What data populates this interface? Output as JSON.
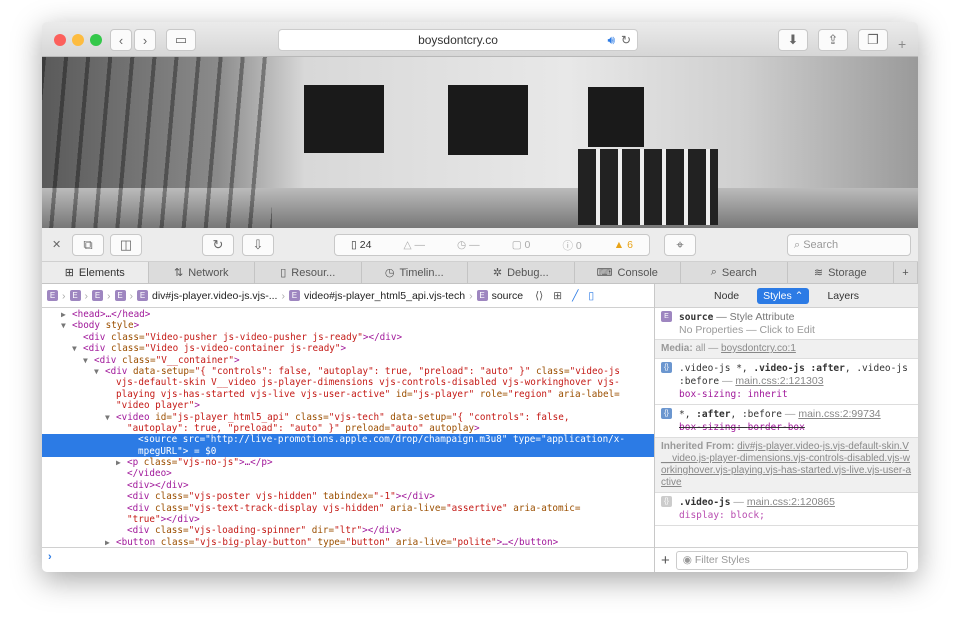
{
  "browser": {
    "url": "boysdontcry.co"
  },
  "toolbar": {
    "resources_count": "24",
    "errors": "—",
    "timeline": "—",
    "logs": "0",
    "errors_count": "0",
    "warnings": "6",
    "search_placeholder": "Search"
  },
  "tabs": [
    {
      "label": "Elements",
      "icon": "elements-icon"
    },
    {
      "label": "Network",
      "icon": "network-icon"
    },
    {
      "label": "Resour...",
      "icon": "document-icon"
    },
    {
      "label": "Timelin...",
      "icon": "clock-icon"
    },
    {
      "label": "Debug...",
      "icon": "bug-icon"
    },
    {
      "label": "Console",
      "icon": "console-icon"
    },
    {
      "label": "Search",
      "icon": "search-icon"
    },
    {
      "label": "Storage",
      "icon": "storage-icon"
    }
  ],
  "breadcrumb": {
    "items": [
      "div#js-player.video-js.vjs-...",
      "video#js-player_html5_api.vjs-tech",
      "source"
    ]
  },
  "dom_lines": [
    {
      "i": 1,
      "a": "▶",
      "s": [
        [
          "tag",
          "<head>…</head>"
        ]
      ]
    },
    {
      "i": 1,
      "a": "▼",
      "s": [
        [
          "tag",
          "<body "
        ],
        [
          "attr",
          "style"
        ],
        [
          "tag",
          ">"
        ]
      ]
    },
    {
      "i": 2,
      "a": "",
      "s": [
        [
          "tag",
          "<div "
        ],
        [
          "attr",
          "class="
        ],
        [
          "val",
          "\"Video-pusher js-video-pusher js-ready\""
        ],
        [
          "tag",
          "></div>"
        ]
      ]
    },
    {
      "i": 2,
      "a": "▼",
      "s": [
        [
          "tag",
          "<div "
        ],
        [
          "attr",
          "class="
        ],
        [
          "val",
          "\"Video js-video-container js-ready\""
        ],
        [
          "tag",
          ">"
        ]
      ]
    },
    {
      "i": 3,
      "a": "▼",
      "s": [
        [
          "tag",
          "<div "
        ],
        [
          "attr",
          "class="
        ],
        [
          "val",
          "\"V__container\""
        ],
        [
          "tag",
          ">"
        ]
      ]
    },
    {
      "i": 4,
      "a": "▼",
      "s": [
        [
          "tag",
          "<div "
        ],
        [
          "attr",
          "data-setup="
        ],
        [
          "val",
          "\"{ \"controls\": false, \"autoplay\": true, \"preload\": \"auto\" }\""
        ],
        [
          "attr",
          " class="
        ],
        [
          "val",
          "\"video-js"
        ]
      ]
    },
    {
      "i": 5,
      "a": "",
      "s": [
        [
          "val",
          "vjs-default-skin V__video js-player-dimensions vjs-controls-disabled vjs-workinghover vjs-"
        ]
      ]
    },
    {
      "i": 5,
      "a": "",
      "s": [
        [
          "val",
          "playing vjs-has-started vjs-live vjs-user-active\""
        ],
        [
          "attr",
          " id="
        ],
        [
          "val",
          "\"js-player\""
        ],
        [
          "attr",
          " role="
        ],
        [
          "val",
          "\"region\""
        ],
        [
          "attr",
          " aria-label="
        ]
      ]
    },
    {
      "i": 5,
      "a": "",
      "s": [
        [
          "val",
          "\"video player\""
        ],
        [
          "tag",
          ">"
        ]
      ]
    },
    {
      "i": 5,
      "a": "▼",
      "s": [
        [
          "tag",
          "<video "
        ],
        [
          "attr",
          "id="
        ],
        [
          "val",
          "\"js-player_html5_api\""
        ],
        [
          "attr",
          " class="
        ],
        [
          "val",
          "\"vjs-tech\""
        ],
        [
          "attr",
          " data-setup="
        ],
        [
          "val",
          "\"{ \"controls\": false,"
        ]
      ]
    },
    {
      "i": 6,
      "a": "",
      "s": [
        [
          "val",
          "\"autoplay\": true, \"preload\": \"auto\" }\""
        ],
        [
          "attr",
          " preload="
        ],
        [
          "val",
          "\"auto\""
        ],
        [
          "attr",
          " autoplay"
        ],
        [
          "tag",
          ">"
        ]
      ]
    },
    {
      "i": 7,
      "a": "",
      "sel": true,
      "s": [
        [
          "tag",
          "<source "
        ],
        [
          "attr",
          "src="
        ],
        [
          "val",
          "\"http://live-promotions.apple.com/drop/champaign.m3u8\""
        ],
        [
          "attr",
          " type="
        ],
        [
          "val",
          "\"application/x-"
        ]
      ]
    },
    {
      "i": 7,
      "a": "",
      "sel": true,
      "s": [
        [
          "val",
          "mpegURL\""
        ],
        [
          "tag",
          ">"
        ],
        [
          "txt",
          " = $0"
        ]
      ]
    },
    {
      "i": 6,
      "a": "▶",
      "s": [
        [
          "tag",
          "<p "
        ],
        [
          "attr",
          "class="
        ],
        [
          "val",
          "\"vjs-no-js\""
        ],
        [
          "tag",
          ">…</p>"
        ]
      ]
    },
    {
      "i": 6,
      "a": "",
      "s": [
        [
          "tag",
          "</video>"
        ]
      ]
    },
    {
      "i": 6,
      "a": "",
      "s": [
        [
          "tag",
          "<div></div>"
        ]
      ]
    },
    {
      "i": 6,
      "a": "",
      "s": [
        [
          "tag",
          "<div "
        ],
        [
          "attr",
          "class="
        ],
        [
          "val",
          "\"vjs-poster vjs-hidden\""
        ],
        [
          "attr",
          " tabindex="
        ],
        [
          "val",
          "\"-1\""
        ],
        [
          "tag",
          "></div>"
        ]
      ]
    },
    {
      "i": 6,
      "a": "",
      "s": [
        [
          "tag",
          "<div "
        ],
        [
          "attr",
          "class="
        ],
        [
          "val",
          "\"vjs-text-track-display vjs-hidden\""
        ],
        [
          "attr",
          " aria-live="
        ],
        [
          "val",
          "\"assertive\""
        ],
        [
          "attr",
          " aria-atomic="
        ]
      ]
    },
    {
      "i": 6,
      "a": "",
      "s": [
        [
          "val",
          "\"true\""
        ],
        [
          "tag",
          "></div>"
        ]
      ]
    },
    {
      "i": 6,
      "a": "",
      "s": [
        [
          "tag",
          "<div "
        ],
        [
          "attr",
          "class="
        ],
        [
          "val",
          "\"vjs-loading-spinner\""
        ],
        [
          "attr",
          " dir="
        ],
        [
          "val",
          "\"ltr\""
        ],
        [
          "tag",
          "></div>"
        ]
      ]
    },
    {
      "i": 5,
      "a": "▶",
      "s": [
        [
          "tag",
          "<button "
        ],
        [
          "attr",
          "class="
        ],
        [
          "val",
          "\"vjs-big-play-button\""
        ],
        [
          "attr",
          " type="
        ],
        [
          "val",
          "\"button\""
        ],
        [
          "attr",
          " aria-live="
        ],
        [
          "val",
          "\"polite\""
        ],
        [
          "tag",
          ">…</button>"
        ]
      ]
    }
  ],
  "sidebar": {
    "tabs": [
      "Node",
      "Styles",
      "Layers"
    ],
    "style_attr": {
      "selector": "source",
      "label": "— Style Attribute",
      "empty": "No Properties — Click to Edit"
    },
    "media": {
      "label": "Media:",
      "value": "all —",
      "link": "boysdontcry.co:1"
    },
    "rules": [
      {
        "sel1": ".video-js *, ",
        "sel2": ".video-js :after",
        ", ": "",
        "sel3": ", .video-js :before",
        "src": "main.css:2:121303",
        "prop": "box-sizing",
        "val": "inherit"
      },
      {
        "sel1": "*, ",
        "sel2": ":after",
        ", ": "",
        "sel3": ", :before",
        "src": "main.css:2:99734",
        "prop": "box-sizing",
        "val": "border-box"
      }
    ],
    "inherited": {
      "label": "Inherited From:",
      "link": "div#js-player.video-js.vjs-default-skin.V__video.js-player-dimensions.vjs-controls-disabled.vjs-workinghover.vjs-playing.vjs-has-started.vjs-live.vjs-user-active"
    },
    "rule3": {
      "sel": ".video-js",
      "src": "main.css:2:120865",
      "prop": "display: block;"
    },
    "filter_placeholder": "Filter Styles"
  },
  "colors": {
    "accent": "#2c7be5",
    "warning": "#e8a317",
    "tag": "#a0189a",
    "value": "#c41a16"
  }
}
